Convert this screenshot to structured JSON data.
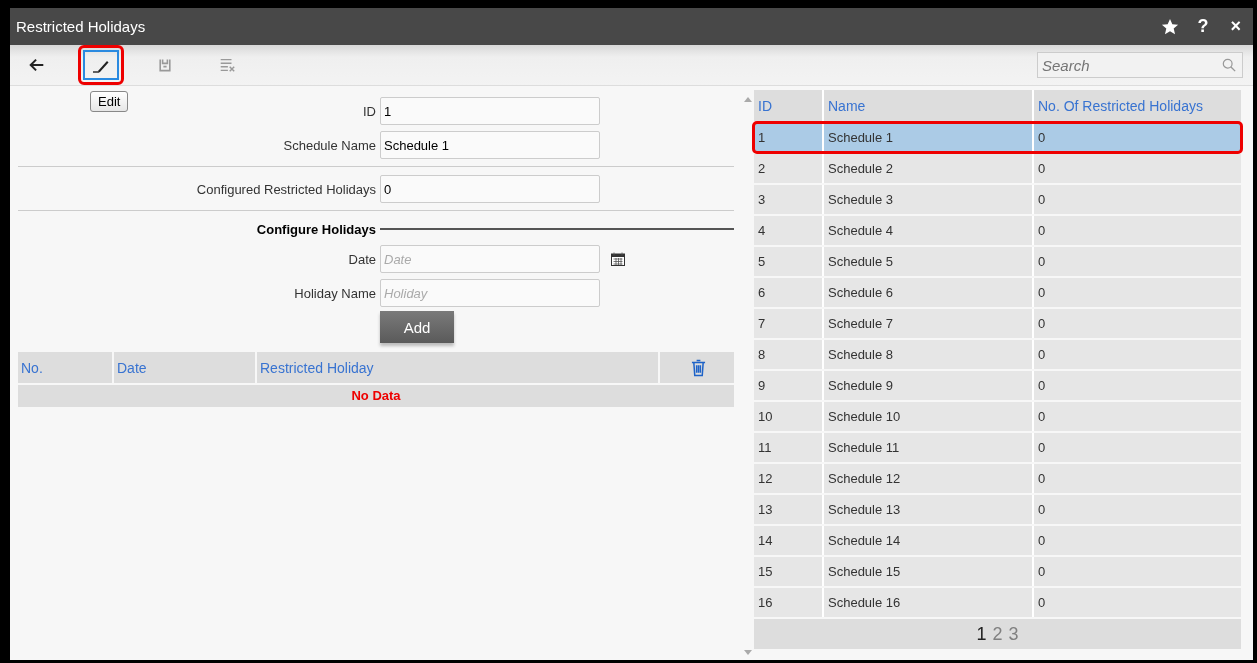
{
  "window": {
    "title": "Restricted Holidays",
    "help": "?",
    "close": "×"
  },
  "toolbar": {
    "items": [
      {
        "kind": "back",
        "annotated": false
      },
      {
        "kind": "edit",
        "annotated": true
      },
      {
        "kind": "save",
        "annotated": false
      },
      {
        "kind": "clear",
        "annotated": false
      }
    ],
    "tooltip": "Edit"
  },
  "search": {
    "placeholder": "Search"
  },
  "form": {
    "fields": [
      {
        "label": "ID",
        "value": "1"
      },
      {
        "label": "Schedule Name",
        "value": "Schedule 1"
      }
    ],
    "configured": {
      "label": "Configured Restricted Holidays",
      "value": "0"
    },
    "section": "Configure Holidays",
    "date": {
      "label": "Date",
      "placeholder": "Date"
    },
    "holiday": {
      "label": "Holiday Name",
      "placeholder": "Holiday"
    },
    "add_button": "Add"
  },
  "holiday_table": {
    "columns": [
      "No.",
      "Date",
      "Restricted Holiday"
    ],
    "empty": "No Data"
  },
  "schedule_table": {
    "columns": [
      "ID",
      "Name",
      "No. Of Restricted Holidays"
    ],
    "rows": [
      {
        "id": "1",
        "name": "Schedule 1",
        "count": "0",
        "selected": true
      },
      {
        "id": "2",
        "name": "Schedule 2",
        "count": "0",
        "selected": false
      },
      {
        "id": "3",
        "name": "Schedule 3",
        "count": "0",
        "selected": false
      },
      {
        "id": "4",
        "name": "Schedule 4",
        "count": "0",
        "selected": false
      },
      {
        "id": "5",
        "name": "Schedule 5",
        "count": "0",
        "selected": false
      },
      {
        "id": "6",
        "name": "Schedule 6",
        "count": "0",
        "selected": false
      },
      {
        "id": "7",
        "name": "Schedule 7",
        "count": "0",
        "selected": false
      },
      {
        "id": "8",
        "name": "Schedule 8",
        "count": "0",
        "selected": false
      },
      {
        "id": "9",
        "name": "Schedule 9",
        "count": "0",
        "selected": false
      },
      {
        "id": "10",
        "name": "Schedule 10",
        "count": "0",
        "selected": false
      },
      {
        "id": "11",
        "name": "Schedule 11",
        "count": "0",
        "selected": false
      },
      {
        "id": "12",
        "name": "Schedule 12",
        "count": "0",
        "selected": false
      },
      {
        "id": "13",
        "name": "Schedule 13",
        "count": "0",
        "selected": false
      },
      {
        "id": "14",
        "name": "Schedule 14",
        "count": "0",
        "selected": false
      },
      {
        "id": "15",
        "name": "Schedule 15",
        "count": "0",
        "selected": false
      },
      {
        "id": "16",
        "name": "Schedule 16",
        "count": "0",
        "selected": false
      }
    ],
    "pages": [
      {
        "label": "1",
        "selected": true
      },
      {
        "label": "2",
        "selected": false
      },
      {
        "label": "3",
        "selected": false
      }
    ]
  }
}
